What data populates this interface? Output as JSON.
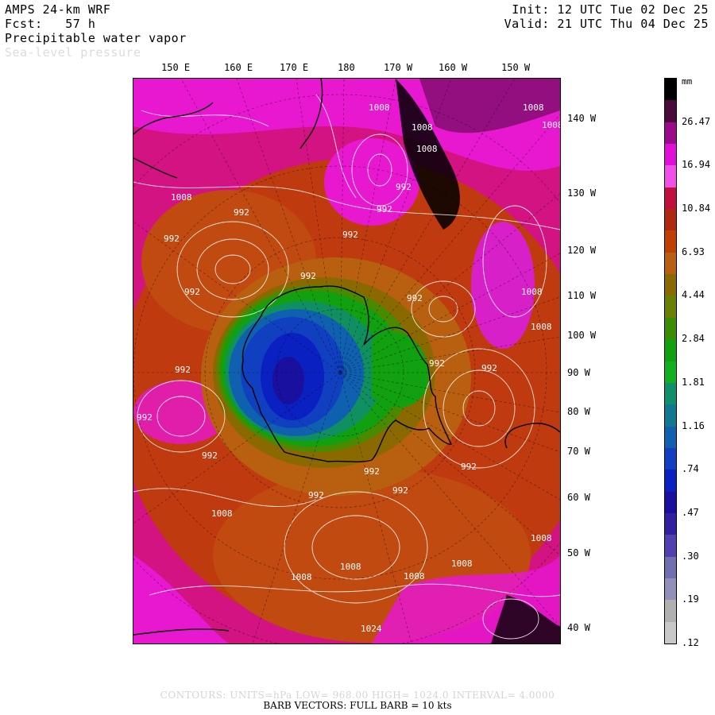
{
  "header": {
    "model": "AMPS 24-km WRF",
    "forecast": "Fcst:   57 h",
    "field": "Precipitable water vapor",
    "overlay": "Sea-level pressure",
    "init": "Init: 12 UTC Tue 02 Dec 25",
    "valid": "Valid: 21 UTC Thu 04 Dec 25"
  },
  "top_labels": [
    "150 E",
    "160 E",
    "170 E",
    "180",
    "170 W",
    "160 W",
    "150 W"
  ],
  "right_labels": [
    "140 W",
    "130 W",
    "120 W",
    "110 W",
    "100 W",
    "90 W",
    "80 W",
    "70 W",
    "60 W",
    "50 W",
    "40 W"
  ],
  "colorbar": {
    "unit": "mm",
    "labels": [
      "26.47",
      "16.94",
      "10.84",
      "6.93",
      "4.44",
      "2.84",
      "1.81",
      "1.16",
      ".74",
      ".47",
      ".30",
      ".19",
      ".12"
    ],
    "colors": [
      "#000000",
      "#4a0a3c",
      "#9a0a8a",
      "#e010d8",
      "#f050e8",
      "#c01040",
      "#b02810",
      "#c04000",
      "#b86010",
      "#8a6a00",
      "#6a8000",
      "#3a8c00",
      "#10a010",
      "#10b020",
      "#10906a",
      "#107890",
      "#1060b0",
      "#1040c0",
      "#0a20c0",
      "#1a10a0",
      "#3020a0",
      "#5040b0",
      "#7070b0",
      "#9090b8",
      "#b0b0b0",
      "#c8c8c8"
    ]
  },
  "isobars": [
    "1008",
    "1008",
    "1008",
    "1008",
    "992",
    "1008",
    "992",
    "992",
    "992",
    "992",
    "992",
    "992",
    "992",
    "992",
    "1008",
    "992",
    "992",
    "992",
    "992",
    "992",
    "992",
    "992",
    "992",
    "1008",
    "1008",
    "1008",
    "1008",
    "1008",
    "1008",
    "1024",
    "1008",
    "1008"
  ],
  "footer": {
    "contours": "CONTOURS:  UNITS=hPa  LOW=  968.00       HIGH=  1024.0       INTERVAL=    4.0000",
    "barbs": "BARB VECTORS:  FULL BARB = 10 kts"
  }
}
